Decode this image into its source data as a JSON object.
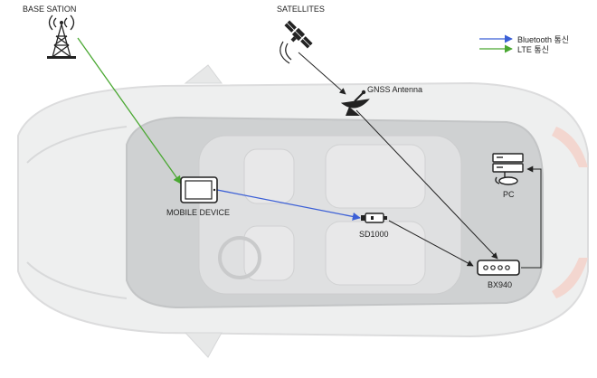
{
  "labels": {
    "base_station": "BASE SATION",
    "satellites": "SATELLITES",
    "gnss_antenna": "GNSS Antenna",
    "mobile_device": "MOBILE DEVICE",
    "sd1000": "SD1000",
    "bx940": "BX940",
    "pc": "PC"
  },
  "legend": {
    "bluetooth": "Bluetooth 통신",
    "lte": "LTE 통신"
  },
  "colors": {
    "bluetooth": "#3b5fd6",
    "lte": "#4aa832",
    "wired": "#222222",
    "car_body": "#e9eaeb",
    "car_glass": "#c9cbcd"
  },
  "icons": {
    "base_station": "cell-tower-icon",
    "satellite": "satellite-icon",
    "gnss": "satellite-dish-icon",
    "mobile": "tablet-icon",
    "sd1000": "usb-dongle-icon",
    "bx940": "receiver-box-icon",
    "pc": "server-pc-icon"
  }
}
